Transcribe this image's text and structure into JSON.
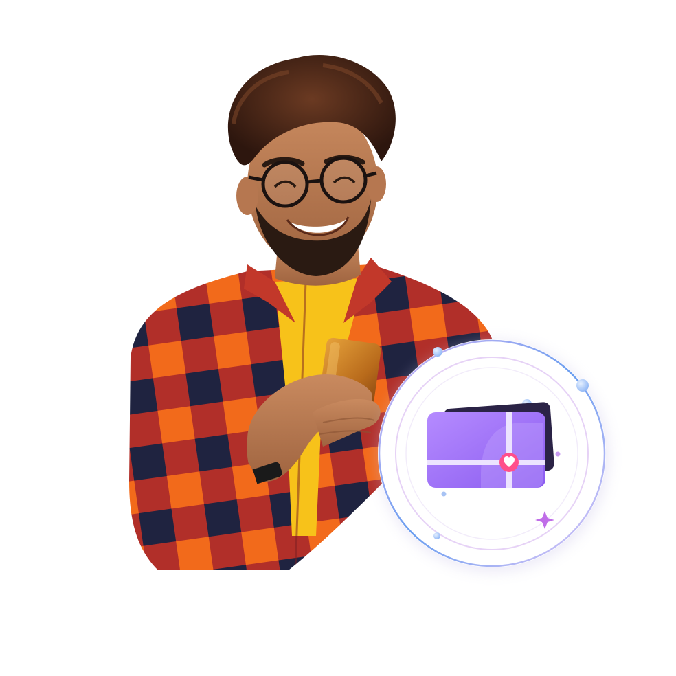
{
  "scene": {
    "background_color": "#ffffff",
    "subject": "smiling-man-with-phone",
    "badge_icon": "gift-card-icon",
    "colors": {
      "shirt_orange": "#f26a1b",
      "shirt_red": "#a6252b",
      "shirt_navy": "#1f2340",
      "tshirt_yellow": "#f7c21a",
      "phone_gold": "#d38a2a",
      "card_purple": "#a06cf5",
      "card_dark": "#2b2346",
      "heart_pink": "#ff4f8b",
      "ring_blue": "#6a9ef0",
      "ring_lilac": "#cba9ee"
    }
  }
}
